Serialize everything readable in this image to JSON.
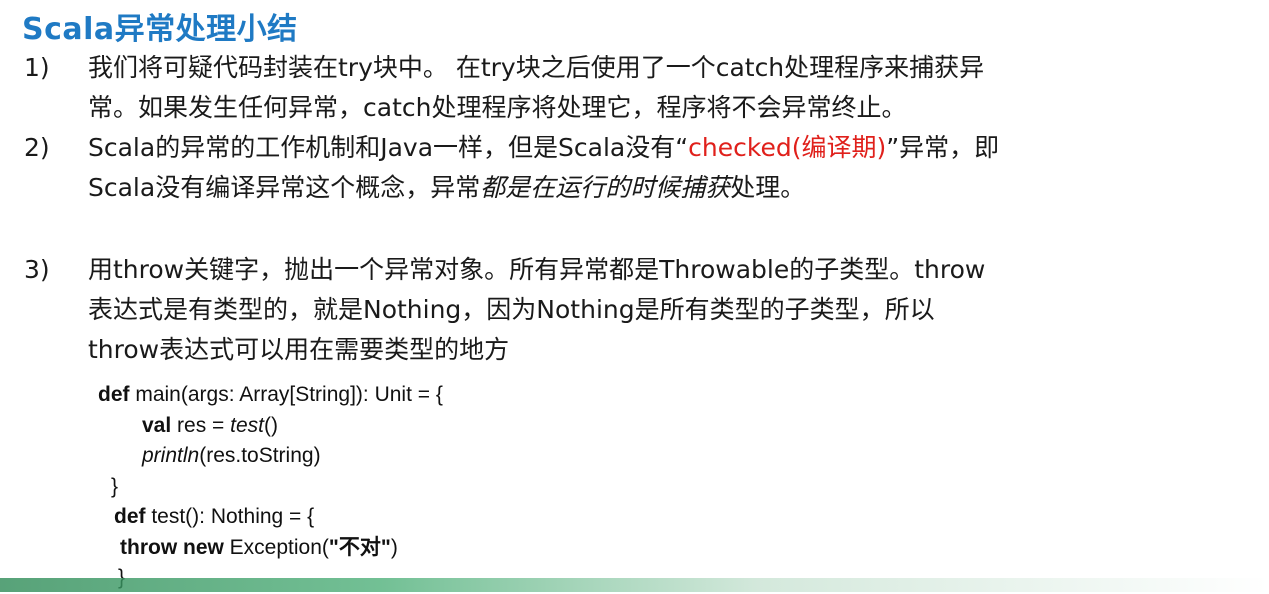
{
  "title": "Scala异常处理小结",
  "items": [
    {
      "num": "1)",
      "lines": [
        "我们将可疑代码封装在try块中。 在try块之后使用了一个catch处理程序来捕获异",
        "常。如果发生任何异常，catch处理程序将处理它，程序将不会异常终止。"
      ]
    },
    {
      "num": "2)",
      "line1_a": "Scala的异常的工作机制和Java一样，但是Scala没有“",
      "line1_red": "checked(编译期)",
      "line1_b": "”异常，即",
      "line2_a": "Scala没有编译异常这个概念，异常",
      "line2_em": "都是在运行的时候捕获",
      "line2_b": "处理。"
    },
    {
      "num": "3)",
      "lines": [
        "用throw关键字，抛出一个异常对象。所有异常都是Throwable的子类型。throw",
        "表达式是有类型的，就是Nothing，因为Nothing是所有类型的子类型，所以",
        "throw表达式可以用在需要类型的地方"
      ]
    }
  ],
  "code": {
    "l1_kw": "def",
    "l1_rest": " main(args: Array[String]):  Unit  = {",
    "l2_kw": "val",
    "l2_a": " res = ",
    "l2_it": "test",
    "l2_b": "()",
    "l3_it": "println",
    "l3_rest": "(res.toString)",
    "l4": "}",
    "l5_kw": "def",
    "l5_rest": " test(): Nothing  = {",
    "l6_kw1": "throw",
    "l6_kw2": "new",
    "l6_a": " Exception(",
    "l6_str": "\"不对\"",
    "l6_b": ")",
    "l7": "}"
  }
}
